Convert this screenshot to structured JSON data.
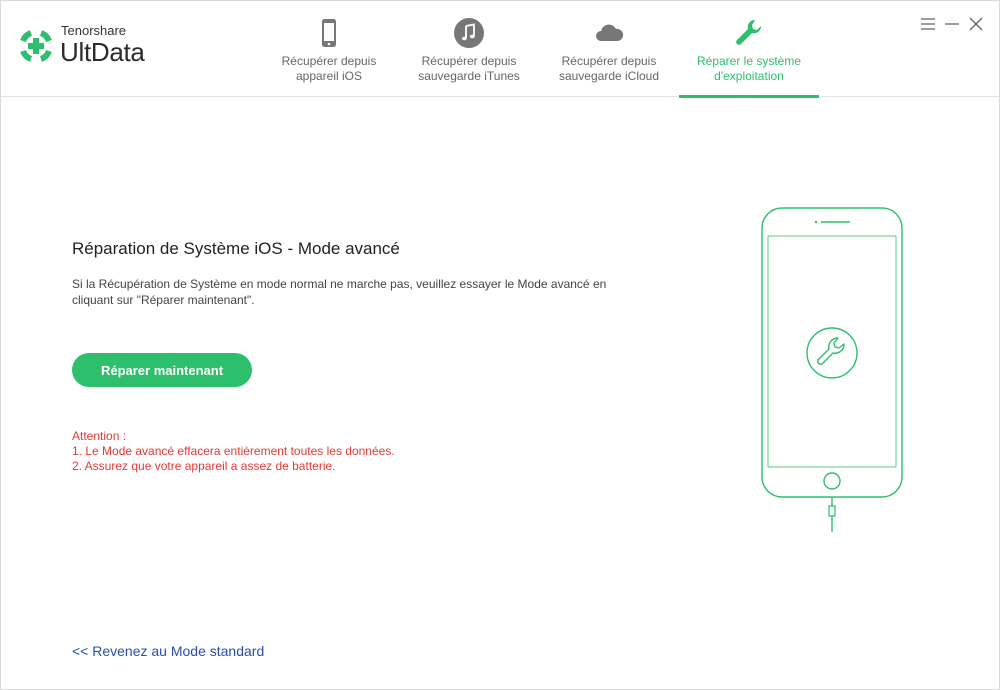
{
  "app": {
    "brand_small": "Tenorshare",
    "brand_big": "UltData"
  },
  "tabs": [
    {
      "label": "Récupérer depuis\nappareil iOS",
      "icon": "phone-icon",
      "active": false
    },
    {
      "label": "Récupérer depuis\nsauvegarde iTunes",
      "icon": "music-note-icon",
      "active": false
    },
    {
      "label": "Récupérer depuis\nsauvegarde iCloud",
      "icon": "cloud-icon",
      "active": false
    },
    {
      "label": "Réparer le système\nd'exploitation",
      "icon": "wrench-icon",
      "active": true
    }
  ],
  "main": {
    "title": "Réparation de Système iOS - Mode avancé",
    "description": "Si la Récupération de Système en mode normal ne marche pas, veuillez essayer le Mode avancé en cliquant sur \"Réparer maintenant\".",
    "repair_button": "Réparer maintenant",
    "attention": {
      "heading": "Attention :",
      "line1": "1. Le Mode avancé effacera entièrement toutes les données.",
      "line2": "2. Assurez que votre appareil a assez de batterie."
    },
    "back_link": "<< Revenez au Mode standard"
  },
  "colors": {
    "accent": "#2dbf6c",
    "warning": "#e53935",
    "link": "#2b4fa8"
  }
}
